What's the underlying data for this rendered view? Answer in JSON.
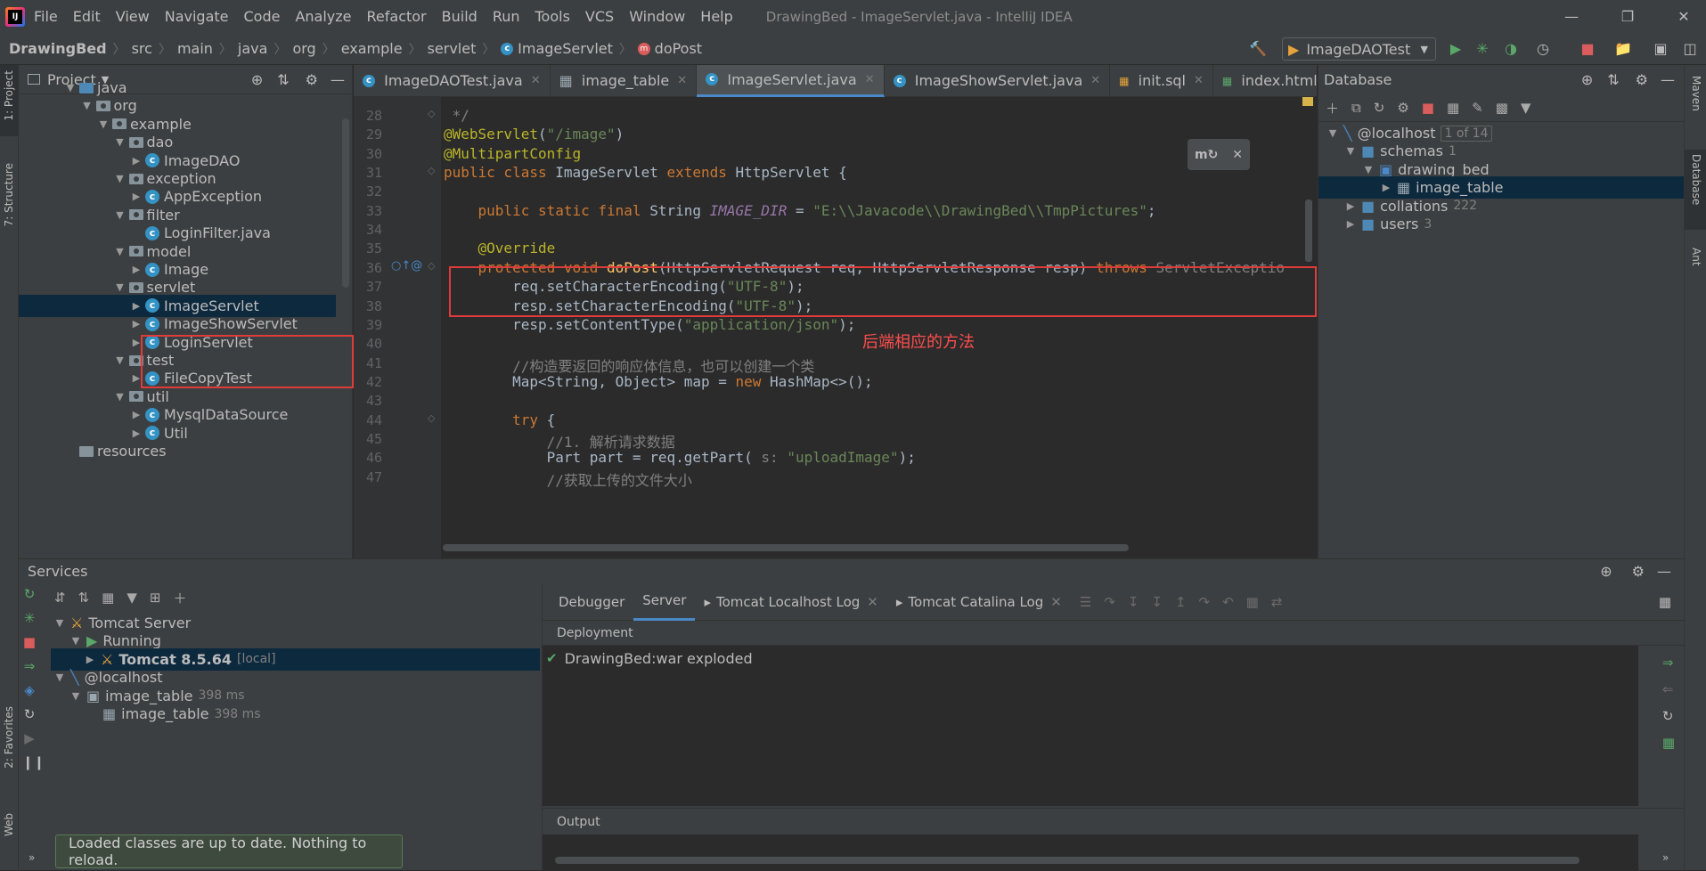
{
  "menubar": {
    "items": [
      "File",
      "Edit",
      "View",
      "Navigate",
      "Code",
      "Analyze",
      "Refactor",
      "Build",
      "Run",
      "Tools",
      "VCS",
      "Window",
      "Help"
    ],
    "window_title": "DrawingBed - ImageServlet.java - IntelliJ IDEA"
  },
  "breadcrumbs": [
    "DrawingBed",
    "src",
    "main",
    "java",
    "org",
    "example",
    "servlet",
    "ImageServlet",
    "doPost"
  ],
  "run_config": "ImageDAOTest",
  "left_stripe": {
    "project": "1: Project",
    "structure": "7: Structure",
    "favorites": "2: Favorites",
    "web": "Web"
  },
  "right_stripe": {
    "maven": "Maven",
    "database": "Database",
    "ant": "Ant"
  },
  "project": {
    "title": "Project",
    "tree": [
      {
        "label": "java",
        "level": 0,
        "kind": "folder-blue",
        "open": true
      },
      {
        "label": "org",
        "level": 1,
        "kind": "pkg",
        "open": true
      },
      {
        "label": "example",
        "level": 2,
        "kind": "pkg",
        "open": true
      },
      {
        "label": "dao",
        "level": 3,
        "kind": "pkg",
        "open": true
      },
      {
        "label": "ImageDAO",
        "level": 4,
        "kind": "class",
        "open": false
      },
      {
        "label": "exception",
        "level": 3,
        "kind": "pkg",
        "open": true
      },
      {
        "label": "AppException",
        "level": 4,
        "kind": "class",
        "open": false
      },
      {
        "label": "filter",
        "level": 3,
        "kind": "pkg",
        "open": true
      },
      {
        "label": "LoginFilter.java",
        "level": 4,
        "kind": "class",
        "open": null
      },
      {
        "label": "model",
        "level": 3,
        "kind": "pkg",
        "open": true
      },
      {
        "label": "Image",
        "level": 4,
        "kind": "class",
        "open": false
      },
      {
        "label": "servlet",
        "level": 3,
        "kind": "pkg",
        "open": true
      },
      {
        "label": "ImageServlet",
        "level": 4,
        "kind": "class",
        "open": false,
        "selected": true
      },
      {
        "label": "ImageShowServlet",
        "level": 4,
        "kind": "class",
        "open": false
      },
      {
        "label": "LoginServlet",
        "level": 4,
        "kind": "class",
        "open": false
      },
      {
        "label": "test",
        "level": 3,
        "kind": "pkg",
        "open": true
      },
      {
        "label": "FileCopyTest",
        "level": 4,
        "kind": "class",
        "open": false
      },
      {
        "label": "util",
        "level": 3,
        "kind": "pkg",
        "open": true
      },
      {
        "label": "MysqlDataSource",
        "level": 4,
        "kind": "class",
        "open": false
      },
      {
        "label": "Util",
        "level": 4,
        "kind": "class",
        "open": false
      },
      {
        "label": "resources",
        "level": 0,
        "kind": "folder",
        "open": null
      }
    ]
  },
  "editor": {
    "tabs": [
      "ImageDAOTest.java",
      "image_table",
      "ImageServlet.java",
      "ImageShowServlet.java",
      "init.sql",
      "index.html"
    ],
    "active_tab": 2,
    "lines": [
      {
        "n": "28",
        "html": "<span class='cm'> */</span>"
      },
      {
        "n": "29",
        "html": "<span class='an'>@WebServlet</span>(<span class='st'>\"/image\"</span>)"
      },
      {
        "n": "30",
        "html": "<span class='an'>@MultipartConfig</span>"
      },
      {
        "n": "31",
        "html": "<span class='kw'>public class </span>ImageServlet <span class='kw'>extends </span>HttpServlet {"
      },
      {
        "n": "32",
        "html": ""
      },
      {
        "n": "33",
        "html": "    <span class='kw'>public static final </span>String <span class='cn'>IMAGE_DIR</span> = <span class='st'>\"E:\\\\Javacode\\\\DrawingBed\\\\TmpPictures\"</span>;"
      },
      {
        "n": "34",
        "html": ""
      },
      {
        "n": "35",
        "html": "    <span class='an'>@Override</span>"
      },
      {
        "n": "36",
        "html": "    <span class='kw'>protected void </span><span class='fn'>doPost</span>(HttpServletRequest req, HttpServletResponse resp) <span class='kw'>throws </span><span class='ex'>ServletExceptio</span>"
      },
      {
        "n": "37",
        "html": "        req.setCharacterEncoding(<span class='st'>\"UTF-8\"</span>);"
      },
      {
        "n": "38",
        "html": "        resp.setCharacterEncoding(<span class='st'>\"UTF-8\"</span>);"
      },
      {
        "n": "39",
        "html": "        resp.setContentType(<span class='st'>\"application/json\"</span>);"
      },
      {
        "n": "40",
        "html": ""
      },
      {
        "n": "41",
        "html": "        <span class='cm'>//构造要返回的响应体信息，也可以创建一个类</span>"
      },
      {
        "n": "42",
        "html": "        Map&lt;String, Object&gt; map = <span class='kw'>new </span>HashMap&lt;&gt;();"
      },
      {
        "n": "43",
        "html": ""
      },
      {
        "n": "44",
        "html": "        <span class='kw'>try </span>{"
      },
      {
        "n": "45",
        "html": "            <span class='cm'>//1. 解析请求数据</span>"
      },
      {
        "n": "46",
        "html": "            Part part = req.getPart( <span class='cm'>s:</span> <span class='st'>\"uploadImage\"</span>);"
      },
      {
        "n": "47",
        "html": "            <span class='cm'>//获取上传的文件大小</span>"
      }
    ],
    "annotation": "后端相应的方法"
  },
  "database": {
    "title": "Database",
    "tree": [
      {
        "label": "@localhost",
        "extra": "1 of 14",
        "level": 0
      },
      {
        "label": "schemas",
        "extra": "1",
        "level": 1
      },
      {
        "label": "drawing_bed",
        "extra": "",
        "level": 2
      },
      {
        "label": "image_table",
        "extra": "",
        "level": 3,
        "selected": true
      },
      {
        "label": "collations",
        "extra": "222",
        "level": 1
      },
      {
        "label": "users",
        "extra": "3",
        "level": 1
      }
    ]
  },
  "services": {
    "title": "Services",
    "tree": [
      {
        "label": "Tomcat Server",
        "extra": ""
      },
      {
        "label": "Running",
        "extra": ""
      },
      {
        "label": "Tomcat 8.5.64",
        "extra": "[local]"
      },
      {
        "label": "@localhost",
        "extra": ""
      },
      {
        "label": "image_table",
        "extra": "398 ms"
      },
      {
        "label": "image_table",
        "extra": "398 ms"
      }
    ],
    "tabs": [
      "Debugger",
      "Server",
      "Tomcat Localhost Log",
      "Tomcat Catalina Log"
    ],
    "deployment_label": "Deployment",
    "deployment_item": "DrawingBed:war exploded",
    "output_label": "Output"
  },
  "toast": "Loaded classes are up to date. Nothing to reload."
}
